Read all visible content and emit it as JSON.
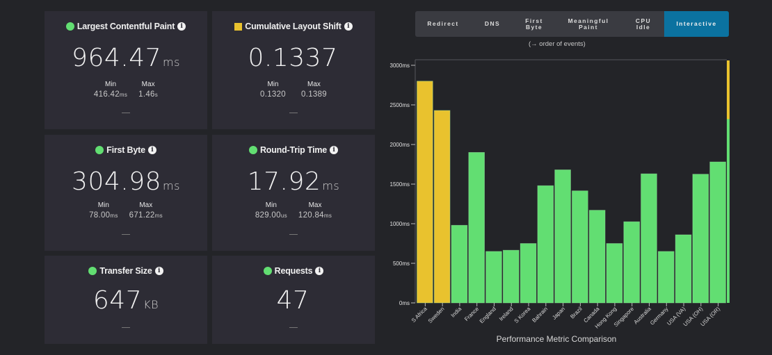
{
  "cards": [
    {
      "title": "Largest Contentful Paint",
      "status": "good",
      "value": "964.47",
      "unit": "ms",
      "min_label": "Min",
      "min_value": "416.42",
      "min_unit": "ms",
      "max_label": "Max",
      "max_value": "1.46",
      "max_unit": "s"
    },
    {
      "title": "Cumulative Layout Shift",
      "status": "needs-improvement",
      "value": "0.1337",
      "unit": "",
      "min_label": "Min",
      "min_value": "0.1320",
      "min_unit": "",
      "max_label": "Max",
      "max_value": "0.1389",
      "max_unit": ""
    },
    {
      "title": "First Byte",
      "status": "good",
      "value": "304.98",
      "unit": "ms",
      "min_label": "Min",
      "min_value": "78.00",
      "min_unit": "ms",
      "max_label": "Max",
      "max_value": "671.22",
      "max_unit": "ms"
    },
    {
      "title": "Round-Trip Time",
      "status": "good",
      "value": "17.92",
      "unit": "ms",
      "min_label": "Min",
      "min_value": "829.00",
      "min_unit": "us",
      "max_label": "Max",
      "max_value": "120.84",
      "max_unit": "ms"
    },
    {
      "title": "Transfer Size",
      "status": "good",
      "value": "647",
      "unit": "KB"
    },
    {
      "title": "Requests",
      "status": "good",
      "value": "47",
      "unit": ""
    }
  ],
  "colors": {
    "good": "#62de72",
    "needs-improvement": "#e9c22e",
    "active_tab": "#0b72a0",
    "info": "#f2f2f2"
  },
  "tabs": [
    {
      "label": "Redirect",
      "active": false
    },
    {
      "label": "DNS",
      "active": false
    },
    {
      "label": "First Byte",
      "active": false
    },
    {
      "label": "Meaningful Paint",
      "active": false
    },
    {
      "label": "CPU Idle",
      "active": false
    },
    {
      "label": "Interactive",
      "active": true
    }
  ],
  "order_note": "(→ order of events)",
  "chart_data": {
    "type": "bar",
    "title": "",
    "xlabel": "Performance Metric Comparison",
    "ylabel": "",
    "ylim": [
      0,
      3070
    ],
    "yticks": [
      0,
      500,
      1000,
      1500,
      2000,
      2500,
      3000
    ],
    "ytick_labels": [
      "0ms",
      "500ms",
      "1000ms",
      "1500ms",
      "2000ms",
      "2500ms",
      "3000ms"
    ],
    "categories": [
      "S Africa",
      "Sweden",
      "India",
      "France",
      "England",
      "Ireland",
      "S Korea",
      "Bahrain",
      "Japan",
      "Brazil",
      "Canada",
      "Hong Kong",
      "Singapore",
      "Australia",
      "Germany",
      "USA (VA)",
      "USA (OH)",
      "USA (OR)"
    ],
    "values": [
      2800,
      2430,
      980,
      1900,
      650,
      665,
      750,
      1480,
      1680,
      1415,
      1170,
      750,
      1025,
      1630,
      650,
      860,
      1625,
      1780
    ],
    "bar_status": [
      "needs-improvement",
      "needs-improvement",
      "good",
      "good",
      "good",
      "good",
      "good",
      "good",
      "good",
      "good",
      "good",
      "good",
      "good",
      "good",
      "good",
      "good",
      "good",
      "good"
    ],
    "threshold_scale": {
      "needs_improvement_above": 2320,
      "good_below": 2320
    },
    "grid": false,
    "legend": "none"
  }
}
